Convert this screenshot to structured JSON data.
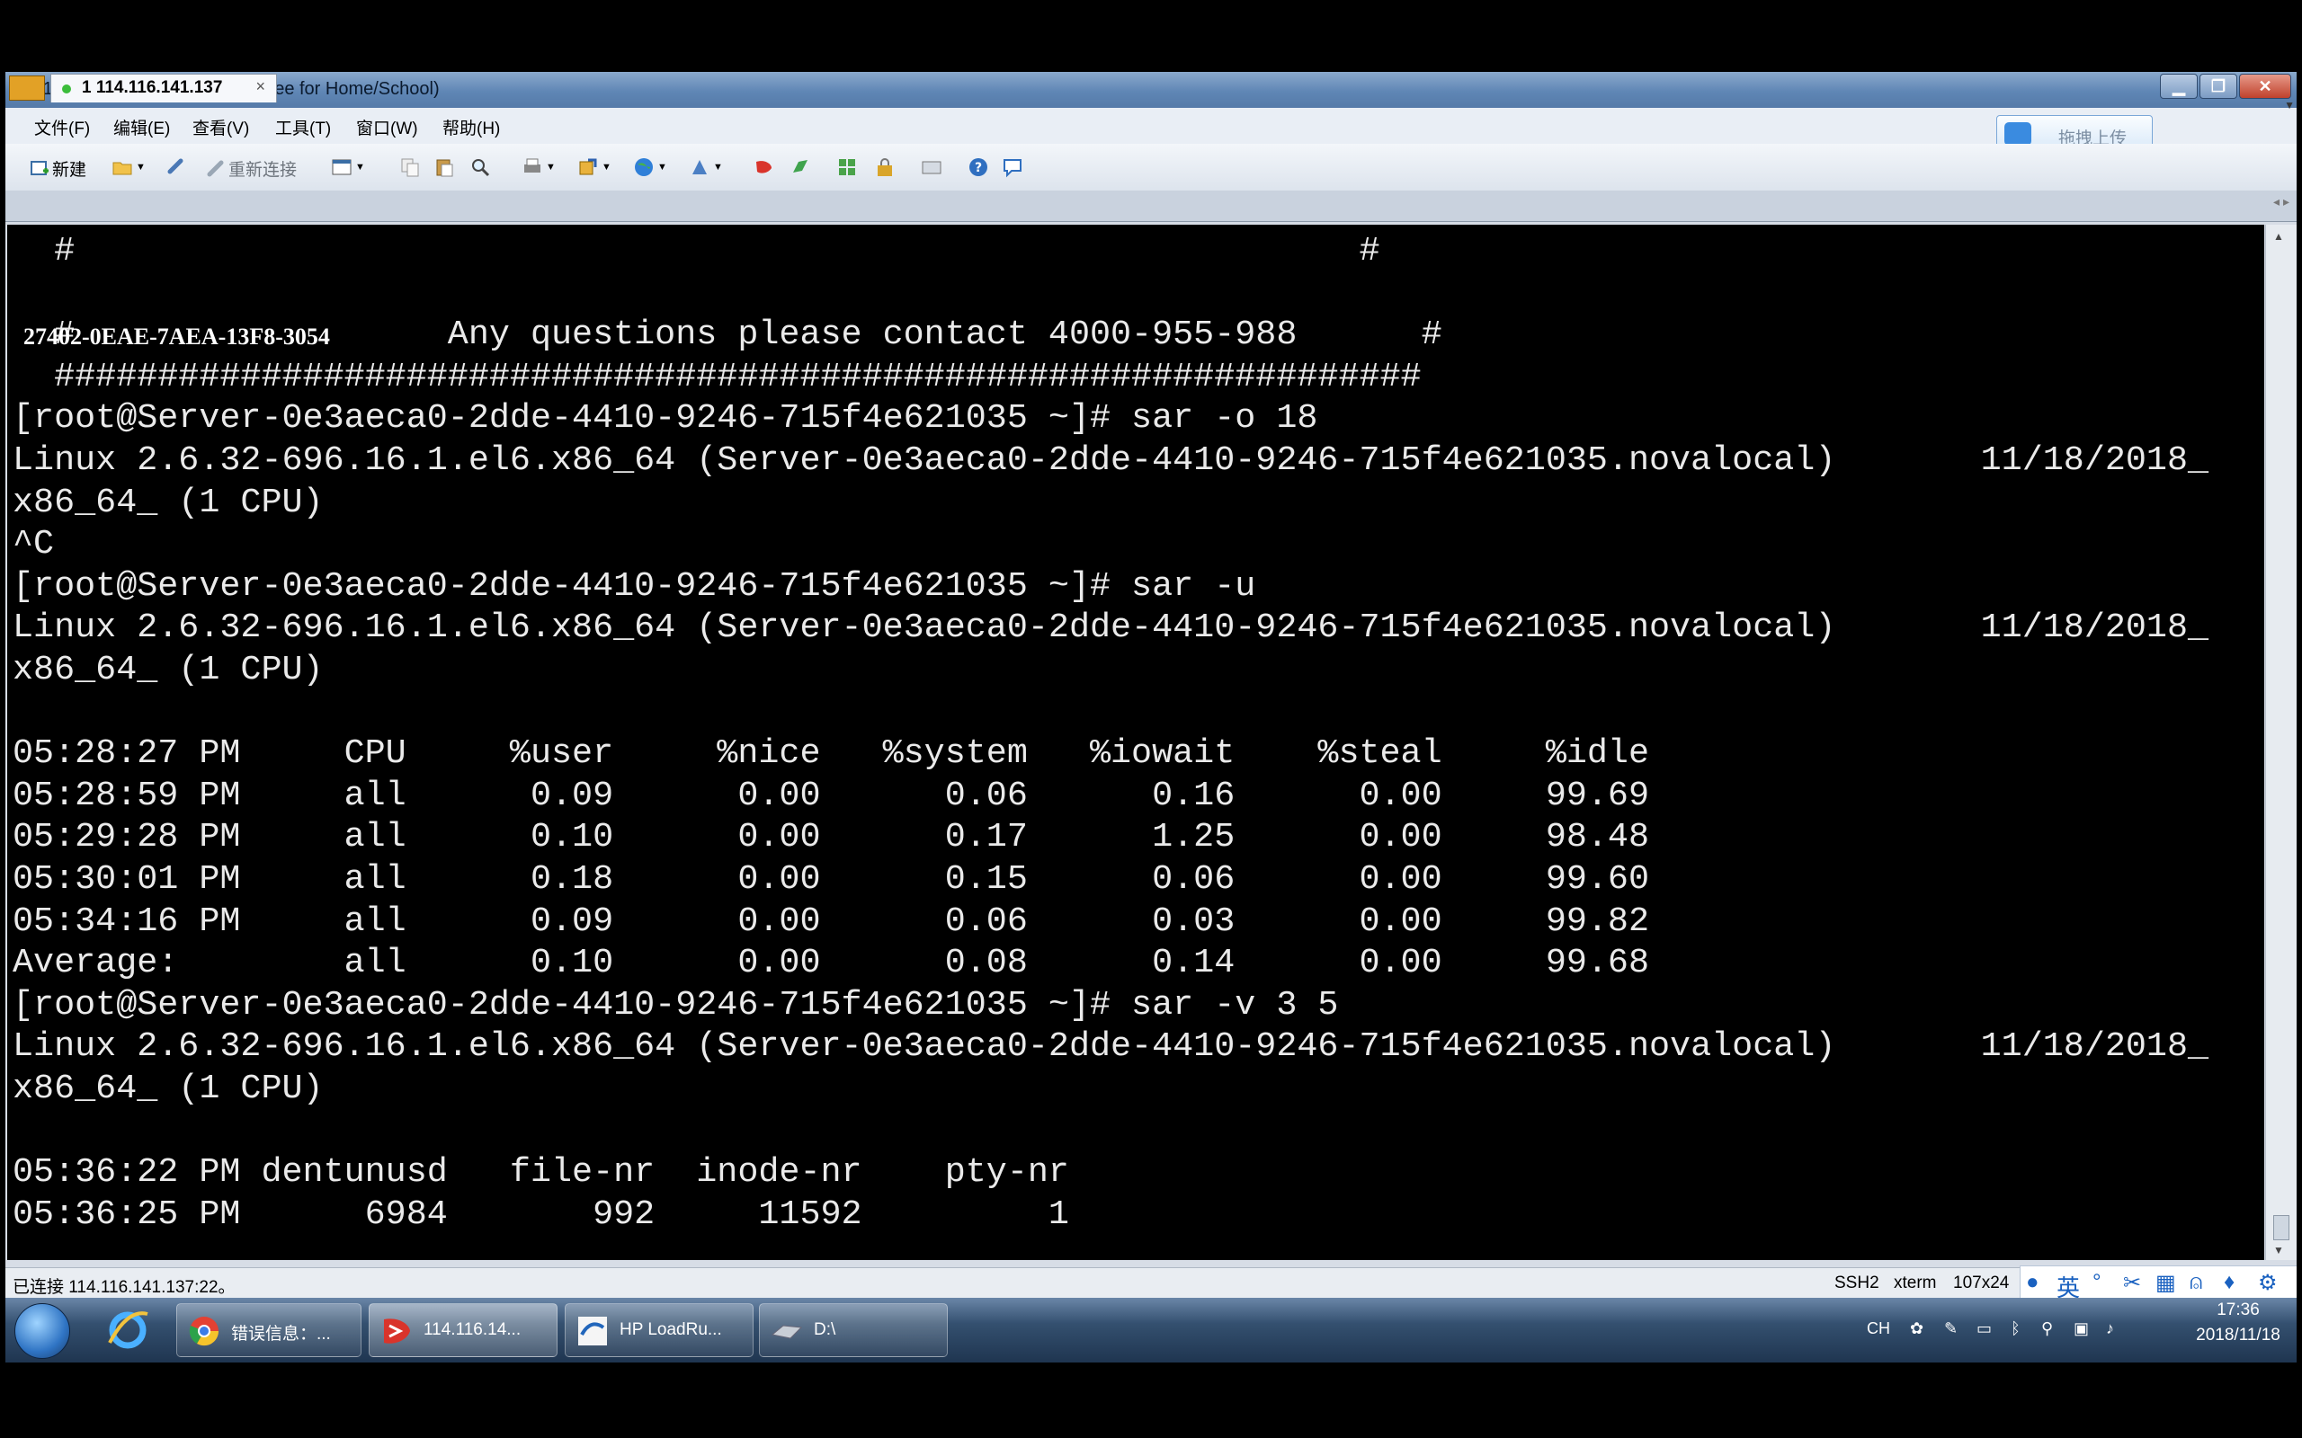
{
  "window": {
    "title": "114.116.141.137 - Xshell 4 (Free for Home/School)",
    "buttons": {
      "minimize": "▁",
      "maximize": "❐",
      "close": "✕"
    }
  },
  "menu": {
    "items": [
      "文件(F)",
      "编辑(E)",
      "查看(V)",
      "工具(T)",
      "窗口(W)",
      "帮助(H)"
    ],
    "upload_label": "拖拽上传"
  },
  "toolbar": {
    "new_label": "新建",
    "reconnect_label": "重新连接"
  },
  "tabs": [
    {
      "label": "1 114.116.141.137",
      "close": "×"
    }
  ],
  "tab_nav": "◂ ▸",
  "terminal": {
    "overlay_code": "27402-0EAE-7AEA-13F8-3054",
    "lines": [
      "  #                                                              #",
      "",
      "  #                  Any questions please contact 4000-955-988      #",
      "  ##################################################################",
      "[root@Server-0e3aeca0-2dde-4410-9246-715f4e621035 ~]# sar -o 18",
      "Linux 2.6.32-696.16.1.el6.x86_64 (Server-0e3aeca0-2dde-4410-9246-715f4e621035.novalocal)       11/18/2018_",
      "x86_64_ (1 CPU)",
      "^C",
      "[root@Server-0e3aeca0-2dde-4410-9246-715f4e621035 ~]# sar -u",
      "Linux 2.6.32-696.16.1.el6.x86_64 (Server-0e3aeca0-2dde-4410-9246-715f4e621035.novalocal)       11/18/2018_",
      "x86_64_ (1 CPU)",
      "",
      "05:28:27 PM     CPU     %user     %nice   %system   %iowait    %steal     %idle",
      "05:28:59 PM     all      0.09      0.00      0.06      0.16      0.00     99.69",
      "05:29:28 PM     all      0.10      0.00      0.17      1.25      0.00     98.48",
      "05:30:01 PM     all      0.18      0.00      0.15      0.06      0.00     99.60",
      "05:34:16 PM     all      0.09      0.00      0.06      0.03      0.00     99.82",
      "Average:        all      0.10      0.00      0.08      0.14      0.00     99.68",
      "[root@Server-0e3aeca0-2dde-4410-9246-715f4e621035 ~]# sar -v 3 5",
      "Linux 2.6.32-696.16.1.el6.x86_64 (Server-0e3aeca0-2dde-4410-9246-715f4e621035.novalocal)       11/18/2018_",
      "x86_64_ (1 CPU)",
      "",
      "05:36:22 PM dentunusd   file-nr  inode-nr    pty-nr",
      "05:36:25 PM      6984       992     11592         1"
    ]
  },
  "status": {
    "connection": "已连接 114.116.141.137:22。",
    "protocol": "SSH2",
    "term": "xterm",
    "size": "107x24"
  },
  "ime": {
    "mode": "英"
  },
  "taskbar": {
    "buttons": [
      {
        "label": "错误信息：..."
      },
      {
        "label": "114.116.14..."
      },
      {
        "label": "HP LoadRu..."
      },
      {
        "label": "D:\\"
      }
    ],
    "tray": {
      "lang": "CH"
    },
    "clock": {
      "time": "17:36",
      "date": "2018/11/18"
    }
  },
  "colors": {
    "terminal_bg": "#000000",
    "terminal_fg": "#eaeaea",
    "cursor": "#29e629",
    "titlebar": "#5f86b5",
    "taskbar": "#34506f"
  },
  "icons": [
    "app-icon",
    "new-session-icon",
    "open-folder-icon",
    "reconnect-icon",
    "properties-icon",
    "copy-icon",
    "paste-icon",
    "find-icon",
    "print-icon",
    "transfer-icon",
    "globe-icon",
    "keyboard-icon",
    "xftp-icon",
    "xmanager-icon",
    "layout-icon",
    "lock-icon",
    "compose-icon",
    "help-icon",
    "chat-icon",
    "start-orb-icon",
    "ie-icon",
    "chrome-icon",
    "xshell-icon",
    "loadrunner-icon",
    "folder-icon"
  ]
}
